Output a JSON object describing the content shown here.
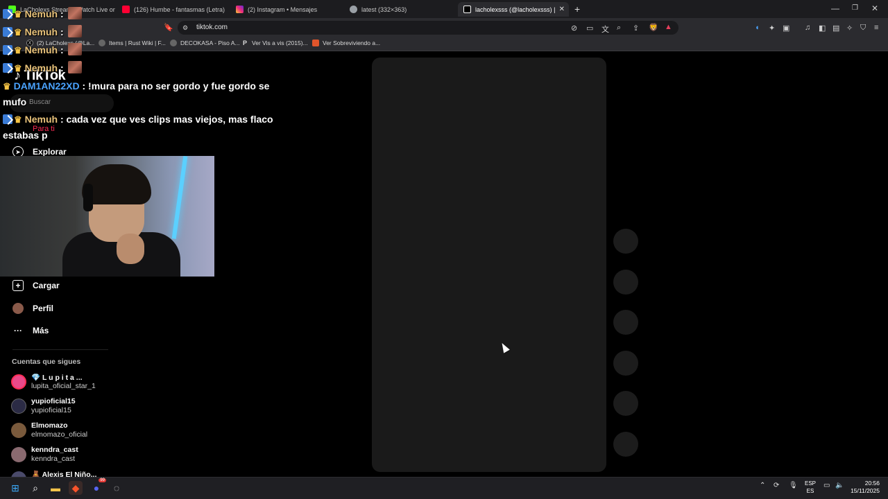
{
  "tabs": [
    {
      "label": "LaCholexs Stream - Watch Live on Ki",
      "color": "#53fc18"
    },
    {
      "label": "(126) Humbe - fantasmas (Letra) - Yo",
      "color": "#ff0033"
    },
    {
      "label": "(2) Instagram • Mensajes",
      "color": "#e1306c"
    },
    {
      "label": "latest (332×363)",
      "color": "#9aa0a6"
    },
    {
      "label": "lacholexsss (@lacholexsss) | TikT",
      "color": "#ffffff"
    }
  ],
  "address": {
    "url": "tiktok.com"
  },
  "bookmarks": [
    {
      "label": "(2) LaCholexs (@La..."
    },
    {
      "label": "Items | Rust Wiki | F..."
    },
    {
      "label": "DECOKASA - Piso A..."
    },
    {
      "label": "Ver Vis a vis (2015)..."
    },
    {
      "label": "Ver Sobreviviendo a..."
    }
  ],
  "tiktok": {
    "logo": "TikTok",
    "search_placeholder": "Buscar",
    "nav": {
      "para_ti": "Para ti",
      "explorar": "Explorar",
      "cargar": "Cargar",
      "perfil": "Perfil",
      "mas": "Más"
    },
    "following_title": "Cuentas que sigues",
    "accounts": [
      {
        "name": "💎 L u p i t a ...",
        "handle": "lupita_oficial_star_1",
        "color": "#e84a8a"
      },
      {
        "name": "yupioficial15",
        "handle": "yupioficial15",
        "color": "#2b2b45"
      },
      {
        "name": "Elmomazo",
        "handle": "elmomazo_oficial",
        "color": "#7a5a3c"
      },
      {
        "name": "kenndra_cast",
        "handle": "kenndra_cast",
        "color": "#8a6a70"
      },
      {
        "name": "🧸 Alexis El Niño...",
        "handle": "",
        "color": "#4a4a6a"
      }
    ]
  },
  "chat": [
    {
      "user": "Nemuh",
      "sep": " :",
      "message": ""
    },
    {
      "user": "Nemuh",
      "sep": " :",
      "message": ""
    },
    {
      "user": "Nemuh",
      "sep": " :",
      "message": ""
    },
    {
      "user": "Nemuh",
      "sep": " :",
      "message": ""
    },
    {
      "user": "DAM1AN22XD",
      "sep": " :",
      "message": " !mura para no ser gordo y fue gordo se"
    },
    {
      "message_cont": "mufo"
    },
    {
      "user": "Nemuh",
      "sep": " :",
      "message": " cada vez que ves clips mas viejos, mas flaco"
    },
    {
      "message_cont": "estabas p"
    }
  ],
  "taskbar": {
    "lang_top": "ESP",
    "lang_bottom": "ES",
    "time": "20:56",
    "date": "15/11/2025",
    "discord_badge": "99"
  }
}
